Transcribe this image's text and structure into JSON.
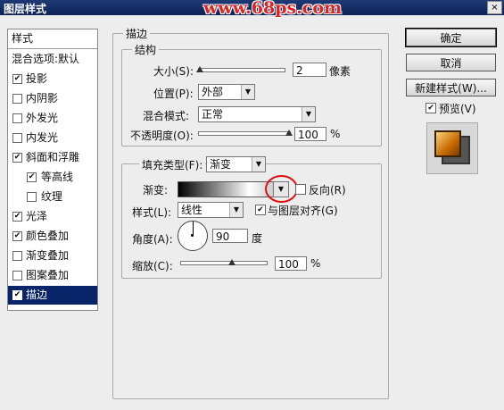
{
  "window": {
    "title": "图层样式",
    "watermark": "www.68ps.com",
    "close": "×"
  },
  "left_panel": {
    "header": "样式",
    "blend_options": "混合选项:默认",
    "items": [
      {
        "label": "投影",
        "checked": true
      },
      {
        "label": "内阴影",
        "checked": false
      },
      {
        "label": "外发光",
        "checked": false
      },
      {
        "label": "内发光",
        "checked": false
      },
      {
        "label": "斜面和浮雕",
        "checked": true
      },
      {
        "label": "等高线",
        "checked": true,
        "sub": true
      },
      {
        "label": "纹理",
        "checked": false,
        "sub": true
      },
      {
        "label": "光泽",
        "checked": true
      },
      {
        "label": "颜色叠加",
        "checked": true
      },
      {
        "label": "渐变叠加",
        "checked": false
      },
      {
        "label": "图案叠加",
        "checked": false
      },
      {
        "label": "描边",
        "checked": true,
        "selected": true
      }
    ]
  },
  "stroke": {
    "section_title": "描边",
    "structure_title": "结构",
    "size_label": "大小(S):",
    "size_value": "2",
    "size_unit": "像素",
    "size_slider_value": 2,
    "position_label": "位置(P):",
    "position_value": "外部",
    "blend_label": "混合模式:",
    "blend_value": "正常",
    "opacity_label": "不透明度(O):",
    "opacity_value": "100",
    "opacity_unit": "%",
    "fill_type_label": "填充类型(F):",
    "fill_type_value": "渐变",
    "gradient_label": "渐变:",
    "reverse_label": "反向(R)",
    "reverse_checked": false,
    "style_label": "样式(L):",
    "style_value": "线性",
    "align_label": "与图层对齐(G)",
    "align_checked": true,
    "angle_label": "角度(A):",
    "angle_value": "90",
    "angle_unit": "度",
    "scale_label": "缩放(C):",
    "scale_value": "100",
    "scale_unit": "%"
  },
  "buttons": {
    "ok": "确定",
    "cancel": "取消",
    "new_style": "新建样式(W)...",
    "preview_label": "预览(V)",
    "preview_checked": true
  },
  "check_mark": "✔",
  "dropdown_arrow": "▼"
}
